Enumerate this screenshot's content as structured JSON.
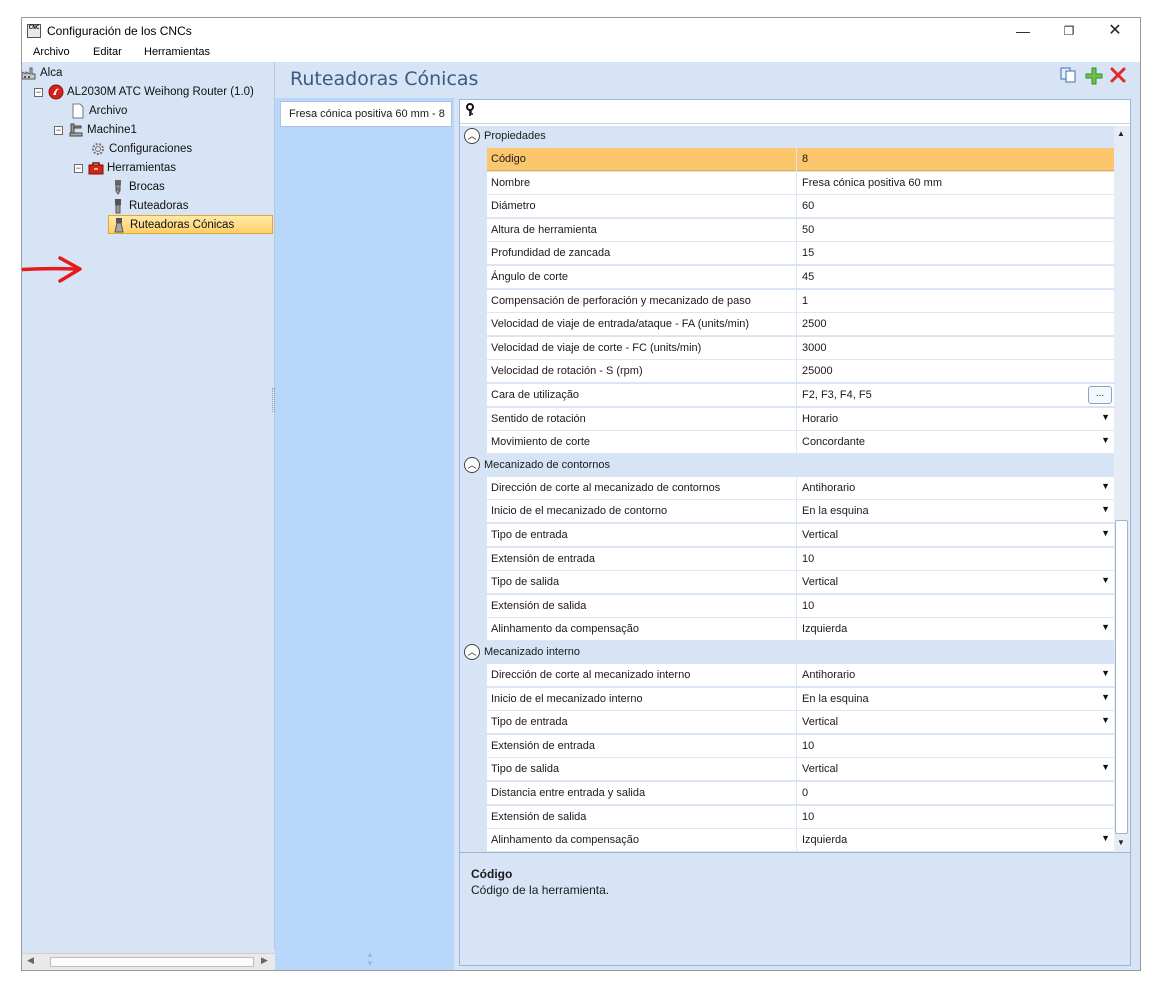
{
  "window": {
    "title": "Configuración de los CNCs",
    "app_icon_text": "CNC",
    "controls": {
      "minimize": "—",
      "maximize": "❐",
      "close": "✕"
    }
  },
  "menu": [
    "Archivo",
    "Editar",
    "Herramientas"
  ],
  "tree": {
    "root": "Alca",
    "machine_config": "AL2030M ATC Weihong Router (1.0)",
    "archivo": "Archivo",
    "machine": "Machine1",
    "configuraciones": "Configuraciones",
    "herramientas": "Herramientas",
    "brocas": "Brocas",
    "ruteadoras": "Ruteadoras",
    "ruteadoras_conicas": "Ruteadoras Cónicas",
    "selected": "Ruteadoras Cónicas"
  },
  "header": {
    "title": "Ruteadoras Cónicas",
    "buttons": [
      "copy-icon",
      "add-icon",
      "delete-icon"
    ]
  },
  "tool_list": {
    "items": [
      "Fresa cónica positiva 60 mm - 8"
    ]
  },
  "property_grid": {
    "search_placeholder": "",
    "categories": [
      {
        "name": "Propiedades",
        "rows": [
          {
            "name": "Código",
            "value": "8",
            "selected": true
          },
          {
            "name": "Nombre",
            "value": "Fresa cónica positiva 60 mm"
          },
          {
            "name": "Diámetro",
            "value": "60"
          },
          {
            "name": "Altura de herramienta",
            "value": "50"
          },
          {
            "name": "Profundidad de zancada",
            "value": "15"
          },
          {
            "name": "Ángulo de corte",
            "value": "45"
          },
          {
            "name": "Compensación de perforación y mecanizado de paso",
            "value": "1"
          },
          {
            "name": "Velocidad de viaje de entrada/ataque - FA (units/min)",
            "value": "2500"
          },
          {
            "name": "Velocidad de viaje de corte - FC (units/min)",
            "value": "3000"
          },
          {
            "name": "Velocidad de rotación - S (rpm)",
            "value": "25000"
          },
          {
            "name": "Cara de utilização",
            "value": "F2, F3, F4, F5",
            "editor": "ellipsis"
          },
          {
            "name": "Sentido de rotación",
            "value": "Horario",
            "editor": "dropdown"
          },
          {
            "name": "Movimiento de corte",
            "value": "Concordante",
            "editor": "dropdown"
          }
        ]
      },
      {
        "name": "Mecanizado de contornos",
        "rows": [
          {
            "name": "Dirección de corte al mecanizado de contornos",
            "value": "Antihorario",
            "editor": "dropdown"
          },
          {
            "name": "Inicio de el mecanizado de contorno",
            "value": "En la esquina",
            "editor": "dropdown"
          },
          {
            "name": "Tipo de entrada",
            "value": "Vertical",
            "editor": "dropdown"
          },
          {
            "name": "Extensión de entrada",
            "value": "10"
          },
          {
            "name": "Tipo de salida",
            "value": "Vertical",
            "editor": "dropdown"
          },
          {
            "name": "Extensión de salida",
            "value": "10"
          },
          {
            "name": "Alinhamento da compensação",
            "value": "Izquierda",
            "editor": "dropdown"
          }
        ]
      },
      {
        "name": "Mecanizado interno",
        "rows": [
          {
            "name": "Dirección de corte al mecanizado interno",
            "value": "Antihorario",
            "editor": "dropdown"
          },
          {
            "name": "Inicio de el mecanizado interno",
            "value": "En la esquina",
            "editor": "dropdown"
          },
          {
            "name": "Tipo de entrada",
            "value": "Vertical",
            "editor": "dropdown"
          },
          {
            "name": "Extensión de entrada",
            "value": "10"
          },
          {
            "name": "Tipo de salida",
            "value": "Vertical",
            "editor": "dropdown"
          },
          {
            "name": "Distancia entre entrada y salida",
            "value": "0"
          },
          {
            "name": "Extensión de salida",
            "value": "10"
          },
          {
            "name": "Alinhamento da compensação",
            "value": "Izquierda",
            "editor": "dropdown"
          }
        ]
      }
    ],
    "description": {
      "title": "Código",
      "text": "Código de la herramienta."
    }
  },
  "colors": {
    "panel_bg": "#d6e4f6",
    "list_bg": "#b9d6fb",
    "selection": "#fcc66c",
    "header_text": "#3d5b80",
    "arrow": "#e8191b"
  }
}
